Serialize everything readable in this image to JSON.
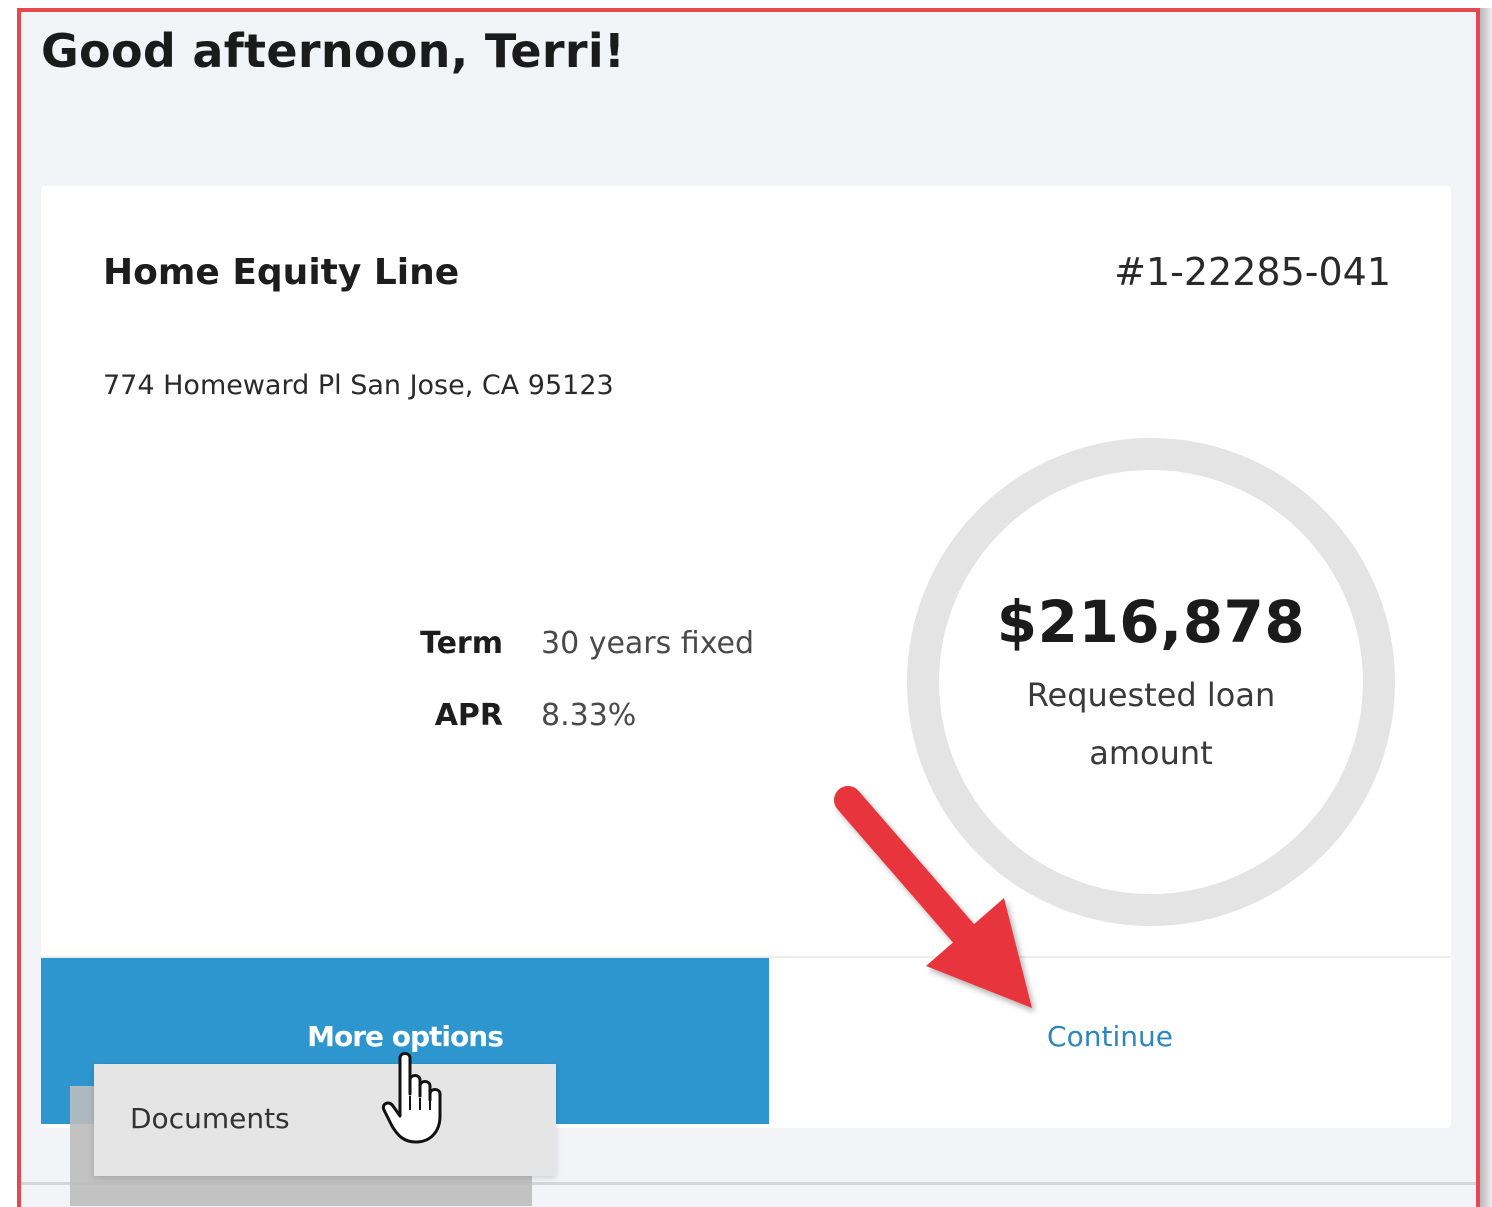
{
  "greeting": "Good afternoon, Terri!",
  "loan": {
    "type": "Home Equity Line",
    "number": "#1-22285-041",
    "address": "774 Homeward Pl San Jose, CA 95123",
    "details": [
      {
        "label": "Term",
        "value": "30 years fixed"
      },
      {
        "label": "APR",
        "value": "8.33%"
      }
    ],
    "amount": "$216,878",
    "amount_caption": "Requested loan amount"
  },
  "actions": {
    "more_options_label": "More options",
    "continue_label": "Continue"
  },
  "dropdown": {
    "items": [
      "Documents"
    ]
  },
  "colors": {
    "frame_border": "#e5484d",
    "primary_button": "#2e96cf",
    "link": "#2e86c1",
    "annotation_arrow": "#e8363d",
    "ring": "#e4e4e4"
  },
  "icons": {
    "cursor": "hand-pointer-icon",
    "annotation": "red-arrow-icon"
  }
}
